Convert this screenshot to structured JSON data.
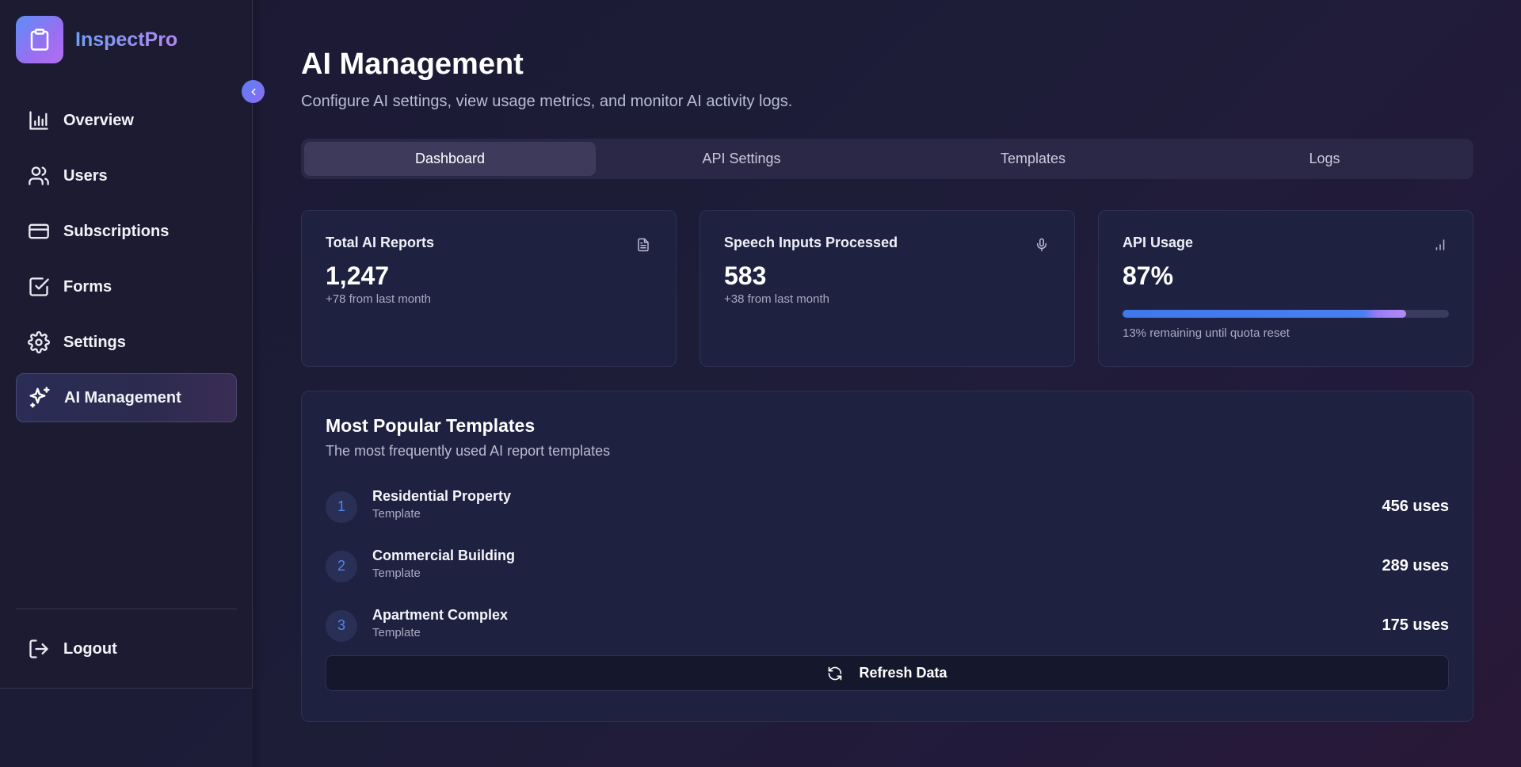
{
  "brand": {
    "name": "InspectPro"
  },
  "sidebar": {
    "items": [
      {
        "label": "Overview",
        "icon": "bar-chart-icon",
        "active": false
      },
      {
        "label": "Users",
        "icon": "users-icon",
        "active": false
      },
      {
        "label": "Subscriptions",
        "icon": "credit-card-icon",
        "active": false
      },
      {
        "label": "Forms",
        "icon": "check-square-icon",
        "active": false
      },
      {
        "label": "Settings",
        "icon": "gear-icon",
        "active": false
      },
      {
        "label": "AI Management",
        "icon": "sparkles-icon",
        "active": true
      }
    ],
    "logout_label": "Logout"
  },
  "header": {
    "title": "AI Management",
    "subtitle": "Configure AI settings, view usage metrics, and monitor AI activity logs."
  },
  "tabs": [
    {
      "label": "Dashboard",
      "active": true
    },
    {
      "label": "API Settings",
      "active": false
    },
    {
      "label": "Templates",
      "active": false
    },
    {
      "label": "Logs",
      "active": false
    }
  ],
  "cards": {
    "reports": {
      "title": "Total AI Reports",
      "value": "1,247",
      "sub": "+78 from last month",
      "icon": "file-text-icon"
    },
    "speech": {
      "title": "Speech Inputs Processed",
      "value": "583",
      "sub": "+38 from last month",
      "icon": "microphone-icon"
    },
    "api": {
      "title": "API Usage",
      "value": "87%",
      "progress": 0.87,
      "sub": "13% remaining until quota reset",
      "icon": "bar-chart-icon"
    }
  },
  "templates": {
    "title": "Most Popular Templates",
    "subtitle": "The most frequently used AI report templates",
    "items": [
      {
        "rank": "1",
        "name": "Residential Property",
        "type": "Template",
        "uses": "456 uses"
      },
      {
        "rank": "2",
        "name": "Commercial Building",
        "type": "Template",
        "uses": "289 uses"
      },
      {
        "rank": "3",
        "name": "Apartment Complex",
        "type": "Template",
        "uses": "175 uses"
      }
    ],
    "refresh_label": "Refresh Data"
  },
  "colors": {
    "accent_blue": "#4f86f2",
    "accent_purple": "#a47ef3",
    "background": "#1d1d38",
    "card": "#1f2140"
  }
}
